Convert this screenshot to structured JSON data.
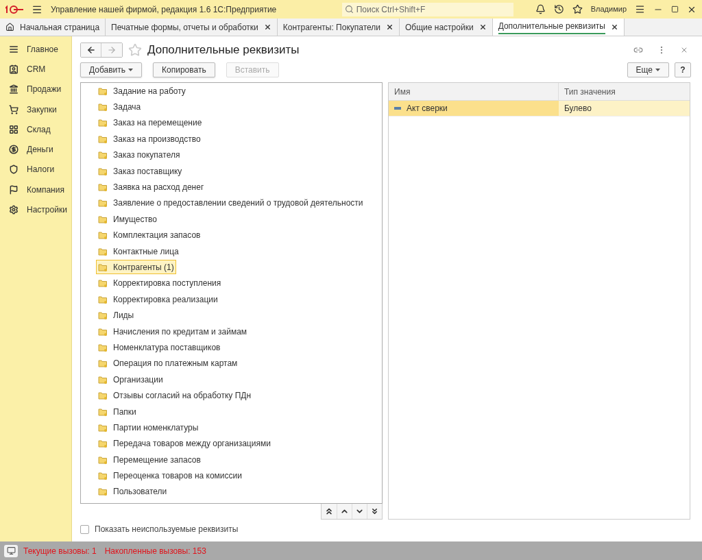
{
  "app_title": "Управление нашей фирмой, редакция 1.6 1С:Предприятие",
  "search": {
    "placeholder": "Поиск Ctrl+Shift+F"
  },
  "user": "Владимир",
  "tabs": [
    {
      "label": "Начальная страница",
      "kind": "home",
      "selected": false
    },
    {
      "label": "Печатные формы, отчеты и обработки",
      "kind": "tab",
      "selected": false
    },
    {
      "label": "Контрагенты: Покупатели",
      "kind": "tab",
      "selected": false
    },
    {
      "label": "Общие настройки",
      "kind": "tab",
      "selected": false
    },
    {
      "label": "Дополнительные реквизиты",
      "kind": "tab",
      "selected": true
    }
  ],
  "sidebar": {
    "items": [
      {
        "label": "Главное"
      },
      {
        "label": "CRM"
      },
      {
        "label": "Продажи"
      },
      {
        "label": "Закупки"
      },
      {
        "label": "Склад"
      },
      {
        "label": "Деньги"
      },
      {
        "label": "Налоги"
      },
      {
        "label": "Компания"
      },
      {
        "label": "Настройки"
      }
    ]
  },
  "form": {
    "title": "Дополнительные реквизиты",
    "toolbar": [
      {
        "label": "Добавить",
        "dropdown": true,
        "disabled": false
      },
      {
        "label": "Копировать",
        "dropdown": false,
        "disabled": false
      },
      {
        "label": "Вставить",
        "dropdown": false,
        "disabled": true
      }
    ],
    "more_button": "Еще",
    "help_button": "?",
    "tree": [
      {
        "label": "Задание на работу",
        "selected": false
      },
      {
        "label": "Задача",
        "selected": false
      },
      {
        "label": "Заказ на перемещение",
        "selected": false
      },
      {
        "label": "Заказ на производство",
        "selected": false
      },
      {
        "label": "Заказ покупателя",
        "selected": false
      },
      {
        "label": "Заказ поставщику",
        "selected": false
      },
      {
        "label": "Заявка на расход денег",
        "selected": false
      },
      {
        "label": "Заявление о предоставлении сведений о трудовой деятельности",
        "selected": false
      },
      {
        "label": "Имущество",
        "selected": false
      },
      {
        "label": "Комплектация запасов",
        "selected": false
      },
      {
        "label": "Контактные лица",
        "selected": false
      },
      {
        "label": "Контрагенты (1)",
        "selected": true
      },
      {
        "label": "Корректировка поступления",
        "selected": false
      },
      {
        "label": "Корректировка реализации",
        "selected": false
      },
      {
        "label": "Лиды",
        "selected": false
      },
      {
        "label": "Начисления по кредитам и займам",
        "selected": false
      },
      {
        "label": "Номенклатура поставщиков",
        "selected": false
      },
      {
        "label": "Операция по платежным картам",
        "selected": false
      },
      {
        "label": "Организации",
        "selected": false
      },
      {
        "label": "Отзывы согласий на обработку ПДн",
        "selected": false
      },
      {
        "label": "Папки",
        "selected": false
      },
      {
        "label": "Партии номенклатуры",
        "selected": false
      },
      {
        "label": "Передача товаров между организациями",
        "selected": false
      },
      {
        "label": "Перемещение запасов",
        "selected": false
      },
      {
        "label": "Переоценка товаров на комиссии",
        "selected": false
      },
      {
        "label": "Пользователи",
        "selected": false
      }
    ],
    "table": {
      "columns": [
        "Имя",
        "Тип значения"
      ],
      "rows": [
        {
          "cells": [
            "Акт сверки",
            "Булево"
          ],
          "selected": true
        }
      ]
    },
    "show_unused": {
      "label": "Показать неиспользуемые реквизиты",
      "checked": false
    }
  },
  "status_bar": {
    "current": "Текущие вызовы: 1",
    "accumulated": "Накопленные вызовы: 153"
  }
}
